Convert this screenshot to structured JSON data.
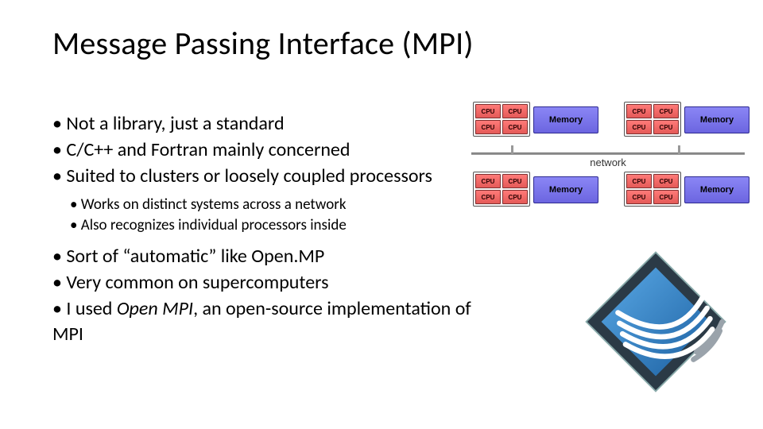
{
  "title": "Message Passing Interface (MPI)",
  "bullets": {
    "b1": "Not a library, just a standard",
    "b2": "C/C++ and Fortran mainly concerned",
    "b3": "Suited to clusters or loosely coupled processors",
    "s1": "Works on distinct systems across a network",
    "s2": "Also recognizes individual processors inside",
    "b4": "Sort of “automatic” like Open.MP",
    "b5": "Very common on supercomputers",
    "b6_pre": "I used ",
    "b6_em": "Open MPI",
    "b6_post": ", an open-source implementation of MPI"
  },
  "diagram": {
    "cpu_label": "CPU",
    "memory_label": "Memory",
    "network_label": "network"
  }
}
